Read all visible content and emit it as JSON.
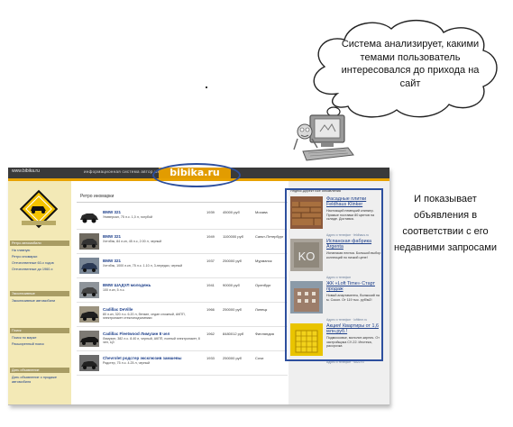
{
  "callout": {
    "cloud_text": "Система анализирует, какими темами пользователь интересовался до прихода на сайт",
    "side_text": "И показывает объявления в соответствии с его недавними запросами"
  },
  "site": {
    "url": "www.bibika.ru",
    "tagline": "информационная  система  автор ынка  Россия",
    "logo": "bibika.ru",
    "sidebar": {
      "sections": [
        {
          "heading": "Ретро автомобили",
          "items": [
            "На главную",
            "Ретро иномарки",
            "Отечественные 60-х годов",
            "Отечественные до 1960-х"
          ]
        },
        {
          "heading": "Эксклюзивные",
          "items": [
            "Эксклюзивные автомобили"
          ]
        },
        {
          "heading": "Поиск",
          "items": [
            "Поиск по марке",
            "Расширенный поиск"
          ]
        },
        {
          "heading": "Дать объявление",
          "items": [
            "Дать объявление о продаже автомобиля"
          ]
        }
      ]
    },
    "content_title": "Ретро иномарки",
    "listings": [
      {
        "title": "BMW 321",
        "desc": "Универсал, 75 л.с. 1,0 л, голубой",
        "year": "1939",
        "price": "45000 руб",
        "city": "Москва"
      },
      {
        "title": "BMW 321",
        "desc": "Хэтчбэк, 84 л.кн, 45 л.с, 2.00 л, черный",
        "year": "1949",
        "price": "1100000 руб",
        "city": "Санкт-Петербург"
      },
      {
        "title": "BMW 321",
        "desc": "Хэтчбэк, 1000 л.кн, 75 л.с. 1.10 л, 3-передач, черный",
        "year": "1937",
        "price": "250000 руб",
        "city": "Мурманск"
      },
      {
        "title": "BMW ШАДУЛ молодежь",
        "desc": "100 л.кн, 5 л.с.",
        "year": "1941",
        "price": "90000 руб",
        "city": "Оренбург"
      },
      {
        "title": "Cadillac DeVille",
        "desc": "80 л.кн, 320 л.с. 6.20 л, бензин, седан сложный, АКПП, электропакет стеклоподъемники",
        "year": "1966",
        "price": "250000 руб",
        "city": "Липецк"
      },
      {
        "title": "Cadillac Fleetwood Лимузин 8 чел",
        "desc": "Лимузин, 382 л.с. 8.40 л, черный, АКПП, полный электропакет, 8 чел, ЦЗ",
        "year": "1962",
        "price": "8480012 руб",
        "city": "Финляндия"
      },
      {
        "title": "Chevrolet родстер эксклюзив замшевы",
        "desc": "Родстер, 75 л.с. 4.25 л, черный",
        "year": "1933",
        "price": "250000 руб",
        "city": "Сочи"
      }
    ],
    "ads": {
      "tabs": "Яндекс.Директ   Все объявления",
      "items": [
        {
          "title": "Фасадные плитки Feldhaus Klinker",
          "text": "Настоящий немецкий клинкер. Прямые поставки 80 цветов на складе. Доставка.",
          "link": "Адрес и телефон · feldhaus.ru"
        },
        {
          "title": "Испанская фабрика Argenta",
          "text": "Испанская плитка. Большой выбор коллекций по низкой цене!",
          "link": "Адрес и телефон"
        },
        {
          "title": "ЖК «Loft Time» Старт продаж",
          "text": "Новый апартаменты, Волжский на м. Сокол. От 119 тыс. руб/м2!",
          "link": "Адрес и телефон · lofttime.ru"
        },
        {
          "title": "Акция! Квартиры от 1,6 млн.руб.!",
          "text": "Подмосковье, монолит-кирпич. От застройщика СУ-22. Ипотека, рассрочка",
          "link": "Адрес и телефон · su22.ru"
        }
      ]
    }
  }
}
